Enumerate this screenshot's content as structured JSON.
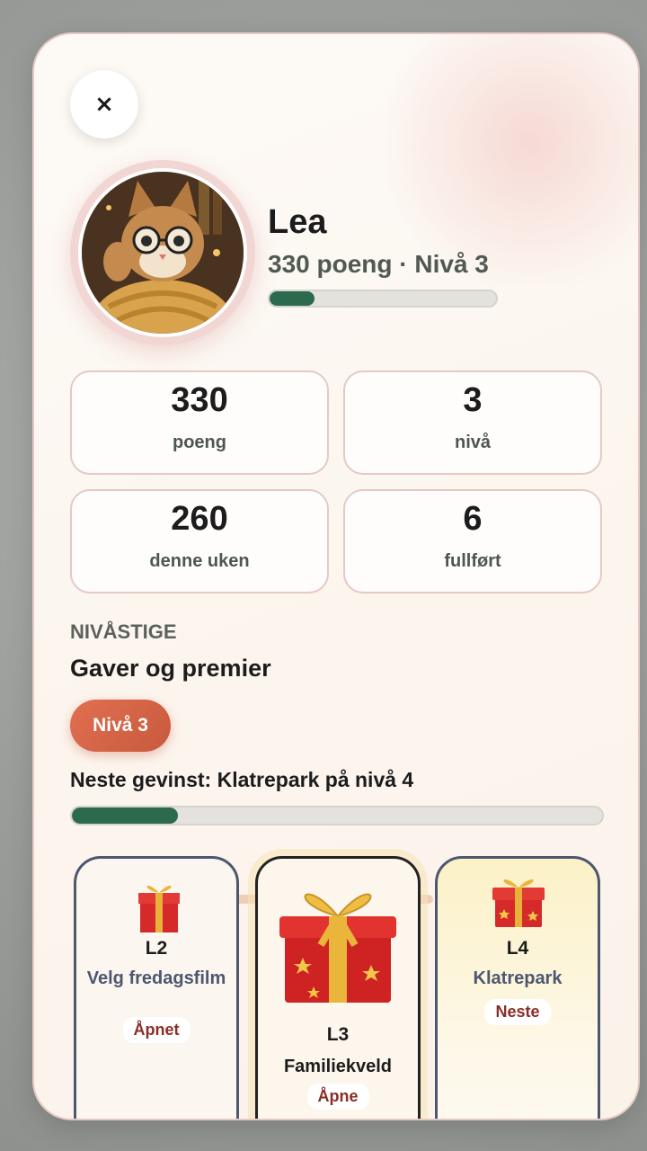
{
  "close": {
    "label": "×"
  },
  "profile": {
    "name": "Lea",
    "subtitle": "330 poeng · Nivå 3",
    "level_progress": 0.2
  },
  "stats": [
    {
      "value": "330",
      "label": "poeng"
    },
    {
      "value": "3",
      "label": "nivå"
    },
    {
      "value": "260",
      "label": "denne uken"
    },
    {
      "value": "6",
      "label": "fullført"
    }
  ],
  "ladder": {
    "eyebrow": "NIVÅSTIGE",
    "title": "Gaver og premier",
    "current_level": "Nivå 3",
    "next_reward": "Neste gevinst: Klatrepark på nivå 4",
    "progress": 0.2
  },
  "rewards": [
    {
      "level": "L2",
      "name": "Velg fredagsfilm",
      "status": "Åpnet",
      "icon": "gift-icon"
    },
    {
      "level": "L3",
      "name": "Familiekveld",
      "status": "Åpne",
      "icon": "gift-icon"
    },
    {
      "level": "L4",
      "name": "Klatrepark",
      "status": "Neste",
      "icon": "gift-icon"
    }
  ],
  "colors": {
    "accent_green": "#2c6a4e",
    "accent_orange": "#d9663f",
    "badge_red": "#8a2e28"
  }
}
